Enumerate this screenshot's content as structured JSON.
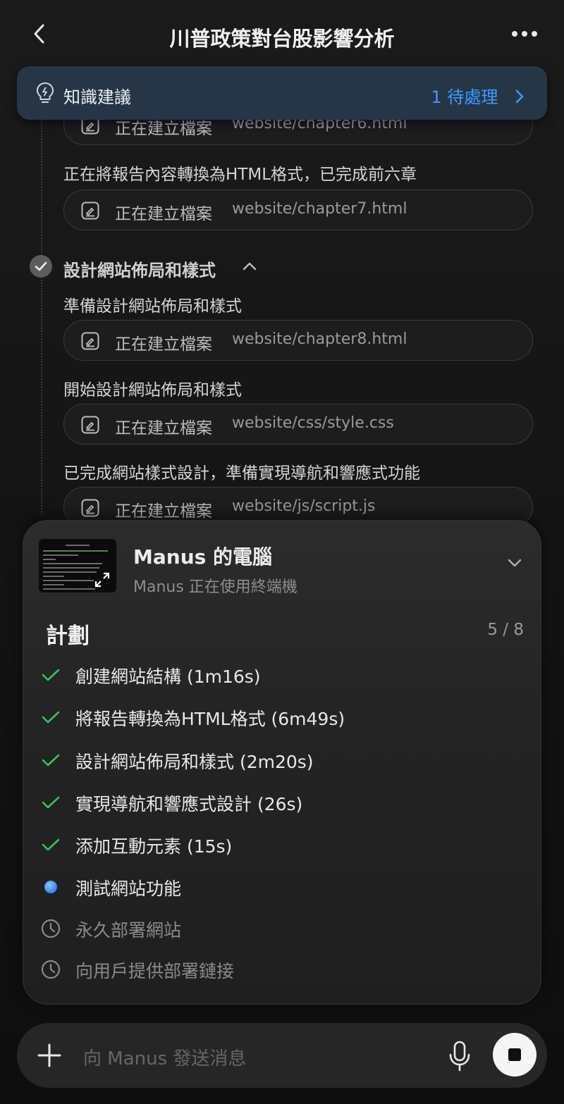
{
  "header": {
    "title": "川普政策對台股影響分析"
  },
  "banner": {
    "label": "知識建議",
    "pending": "1 待處理"
  },
  "timeline": {
    "pill_0": {
      "action": "正在建立檔案",
      "path": "website/chapter6.html"
    },
    "text_0": "正在將報告內容轉換為HTML格式，已完成前六章",
    "pill_1": {
      "action": "正在建立檔案",
      "path": "website/chapter7.html"
    },
    "section_title": "設計網站佈局和樣式",
    "text_1": "準備設計網站佈局和樣式",
    "pill_2": {
      "action": "正在建立檔案",
      "path": "website/chapter8.html"
    },
    "text_2": "開始設計網站佈局和樣式",
    "pill_3": {
      "action": "正在建立檔案",
      "path": "website/css/style.css"
    },
    "text_3": "已完成網站樣式設計，準備實現導航和響應式功能",
    "pill_4": {
      "action": "正在建立檔案",
      "path": "website/js/script.js"
    }
  },
  "computer": {
    "title": "Manus 的電腦",
    "subtitle": "Manus 正在使用終端機"
  },
  "plan": {
    "title": "計劃",
    "progress": "5 / 8",
    "tasks": [
      {
        "label": "創建網站結構 (1m16s)",
        "status": "done"
      },
      {
        "label": "將報告轉換為HTML格式 (6m49s)",
        "status": "done"
      },
      {
        "label": "設計網站佈局和樣式 (2m20s)",
        "status": "done"
      },
      {
        "label": "實現導航和響應式設計 (26s)",
        "status": "done"
      },
      {
        "label": "添加互動元素 (15s)",
        "status": "done"
      },
      {
        "label": "測試網站功能",
        "status": "in-progress"
      },
      {
        "label": "永久部署網站",
        "status": "pending"
      },
      {
        "label": "向用戶提供部署鏈接",
        "status": "pending"
      }
    ]
  },
  "input": {
    "placeholder": "向 Manus 發送消息"
  },
  "colors": {
    "accent": "#3b9cff",
    "check": "#3fbf5a",
    "banner_bg": "#263646"
  }
}
